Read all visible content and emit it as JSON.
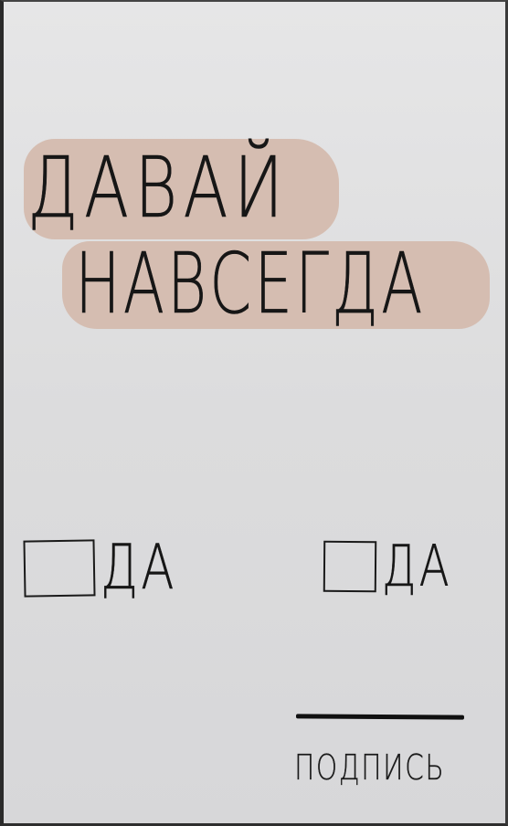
{
  "note": {
    "line_1": "ДАВАЙ",
    "line_2": "НАВСЕГДА",
    "highlight_color": "#d5bdb1",
    "options": [
      {
        "label": "ДА",
        "checked": false
      },
      {
        "label": "ДА",
        "checked": false
      }
    ],
    "signature_label": "ПОДПИСЬ"
  }
}
